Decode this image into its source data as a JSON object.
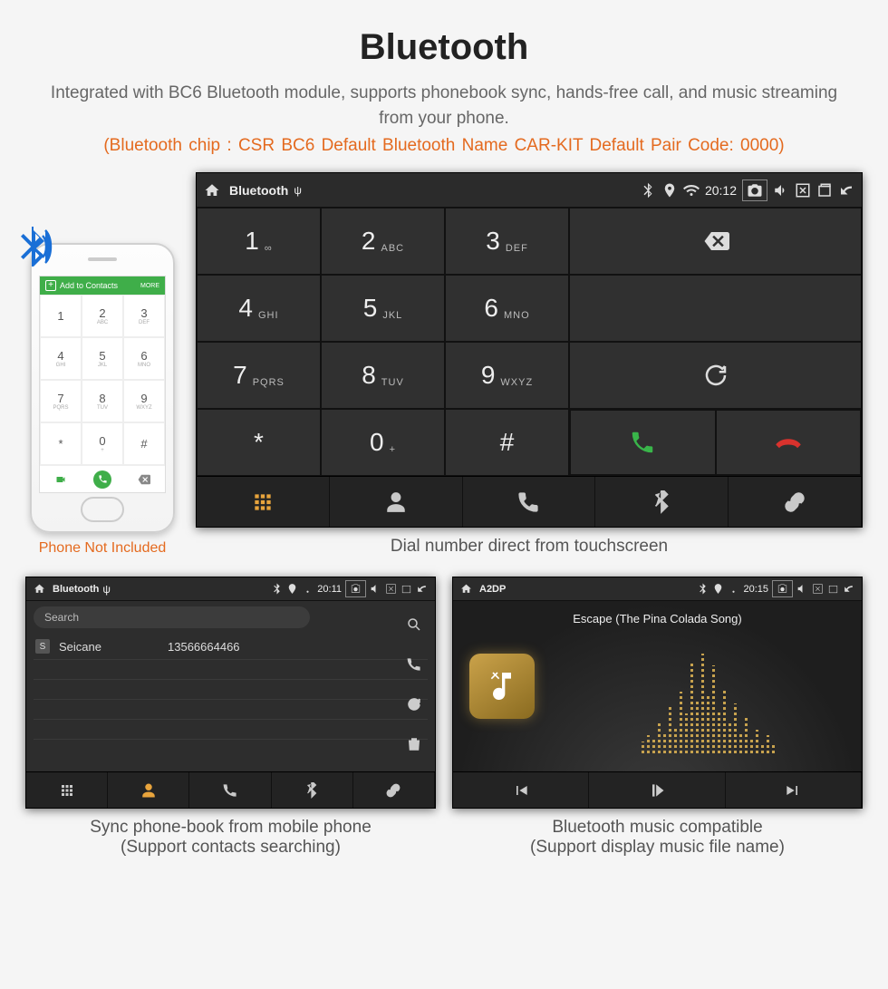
{
  "hero": {
    "title": "Bluetooth",
    "desc": "Integrated with BC6 Bluetooth module, supports phonebook sync, hands-free call, and music streaming from your phone.",
    "specs": "(Bluetooth chip : CSR BC6     Default Bluetooth Name CAR-KIT     Default Pair Code: 0000)"
  },
  "phone_mock": {
    "header": "Add to Contacts",
    "more": "MORE",
    "note": "Phone Not Included",
    "keys": [
      {
        "n": "1",
        "s": ""
      },
      {
        "n": "2",
        "s": "ABC"
      },
      {
        "n": "3",
        "s": "DEF"
      },
      {
        "n": "4",
        "s": "GHI"
      },
      {
        "n": "5",
        "s": "JKL"
      },
      {
        "n": "6",
        "s": "MNO"
      },
      {
        "n": "7",
        "s": "PQRS"
      },
      {
        "n": "8",
        "s": "TUV"
      },
      {
        "n": "9",
        "s": "WXYZ"
      },
      {
        "n": "*",
        "s": ""
      },
      {
        "n": "0",
        "s": "+"
      },
      {
        "n": "#",
        "s": ""
      }
    ]
  },
  "dialer": {
    "status_title": "Bluetooth",
    "clock": "20:12",
    "keys": [
      {
        "n": "1",
        "s": "∞"
      },
      {
        "n": "2",
        "s": "ABC"
      },
      {
        "n": "3",
        "s": "DEF"
      },
      {
        "n": "4",
        "s": "GHI"
      },
      {
        "n": "5",
        "s": "JKL"
      },
      {
        "n": "6",
        "s": "MNO"
      },
      {
        "n": "7",
        "s": "PQRS"
      },
      {
        "n": "8",
        "s": "TUV"
      },
      {
        "n": "9",
        "s": "WXYZ"
      },
      {
        "n": "*",
        "s": ""
      },
      {
        "n": "0",
        "s": "+"
      },
      {
        "n": "#",
        "s": ""
      }
    ],
    "caption": "Dial number direct from touchscreen"
  },
  "phonebook": {
    "status_title": "Bluetooth",
    "clock": "20:11",
    "search_placeholder": "Search",
    "contact_badge": "S",
    "contact_name": "Seicane",
    "contact_number": "13566664466",
    "caption_l1": "Sync phone-book from mobile phone",
    "caption_l2": "(Support contacts searching)"
  },
  "music": {
    "status_title": "A2DP",
    "clock": "20:15",
    "song": "Escape (The Pina Colada Song)",
    "caption_l1": "Bluetooth music compatible",
    "caption_l2": "(Support display music file name)"
  }
}
